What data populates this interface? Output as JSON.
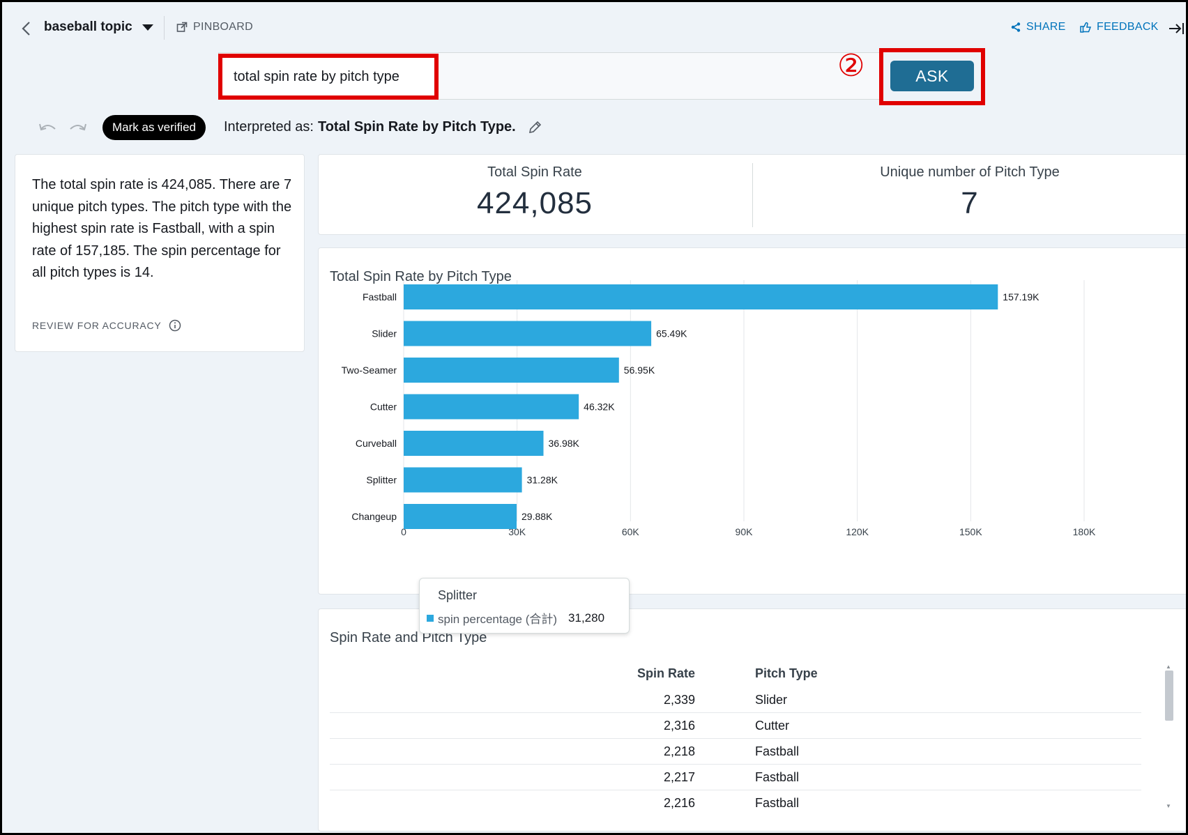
{
  "topbar": {
    "topic": "baseball topic",
    "pinboard": "PINBOARD",
    "share": "SHARE",
    "feedback": "FEEDBACK"
  },
  "search": {
    "query": "total spin rate by pitch type",
    "step_marker": "②",
    "ask_label": "ASK"
  },
  "interpretation": {
    "verify_label": "Mark as verified",
    "prefix": "Interpreted as:",
    "text": "Total Spin Rate by Pitch Type."
  },
  "narrative": {
    "text": "The total spin rate is 424,085. There are 7 unique pitch types. The pitch type with the highest spin rate is Fastball, with a spin rate of 157,185. The spin percentage for all pitch types is 14.",
    "review": "REVIEW FOR ACCURACY"
  },
  "kpis": [
    {
      "label": "Total Spin Rate",
      "value": "424,085"
    },
    {
      "label": "Unique number of Pitch Type",
      "value": "7"
    }
  ],
  "chart_data": {
    "type": "bar",
    "orientation": "horizontal",
    "title": "Total Spin Rate by Pitch Type",
    "categories": [
      "Fastball",
      "Slider",
      "Two-Seamer",
      "Cutter",
      "Curveball",
      "Splitter",
      "Changeup"
    ],
    "values": [
      157185,
      65490,
      56950,
      46320,
      36980,
      31280,
      29880
    ],
    "data_labels": [
      "157.19K",
      "65.49K",
      "56.95K",
      "46.32K",
      "36.98K",
      "31.28K",
      "29.88K"
    ],
    "xlim": [
      0,
      180000
    ],
    "xticks": [
      0,
      30000,
      60000,
      90000,
      120000,
      150000,
      180000
    ],
    "xtick_labels": [
      "0",
      "30K",
      "60K",
      "90K",
      "120K",
      "150K",
      "180K"
    ],
    "grid": true,
    "bar_color": "#2ca8de"
  },
  "tooltip": {
    "title": "Splitter",
    "series": "spin percentage (合計)",
    "value": "31,280"
  },
  "table": {
    "title": "Spin Rate and Pitch Type",
    "headers": [
      "Spin Rate",
      "Pitch Type"
    ],
    "rows": [
      [
        "2,339",
        "Slider"
      ],
      [
        "2,316",
        "Cutter"
      ],
      [
        "2,218",
        "Fastball"
      ],
      [
        "2,217",
        "Fastball"
      ],
      [
        "2,216",
        "Fastball"
      ]
    ]
  },
  "colors": {
    "accent": "#0073bb",
    "ask_button": "#1f6d94",
    "highlight": "#e00000",
    "background": "#eef3f8"
  }
}
